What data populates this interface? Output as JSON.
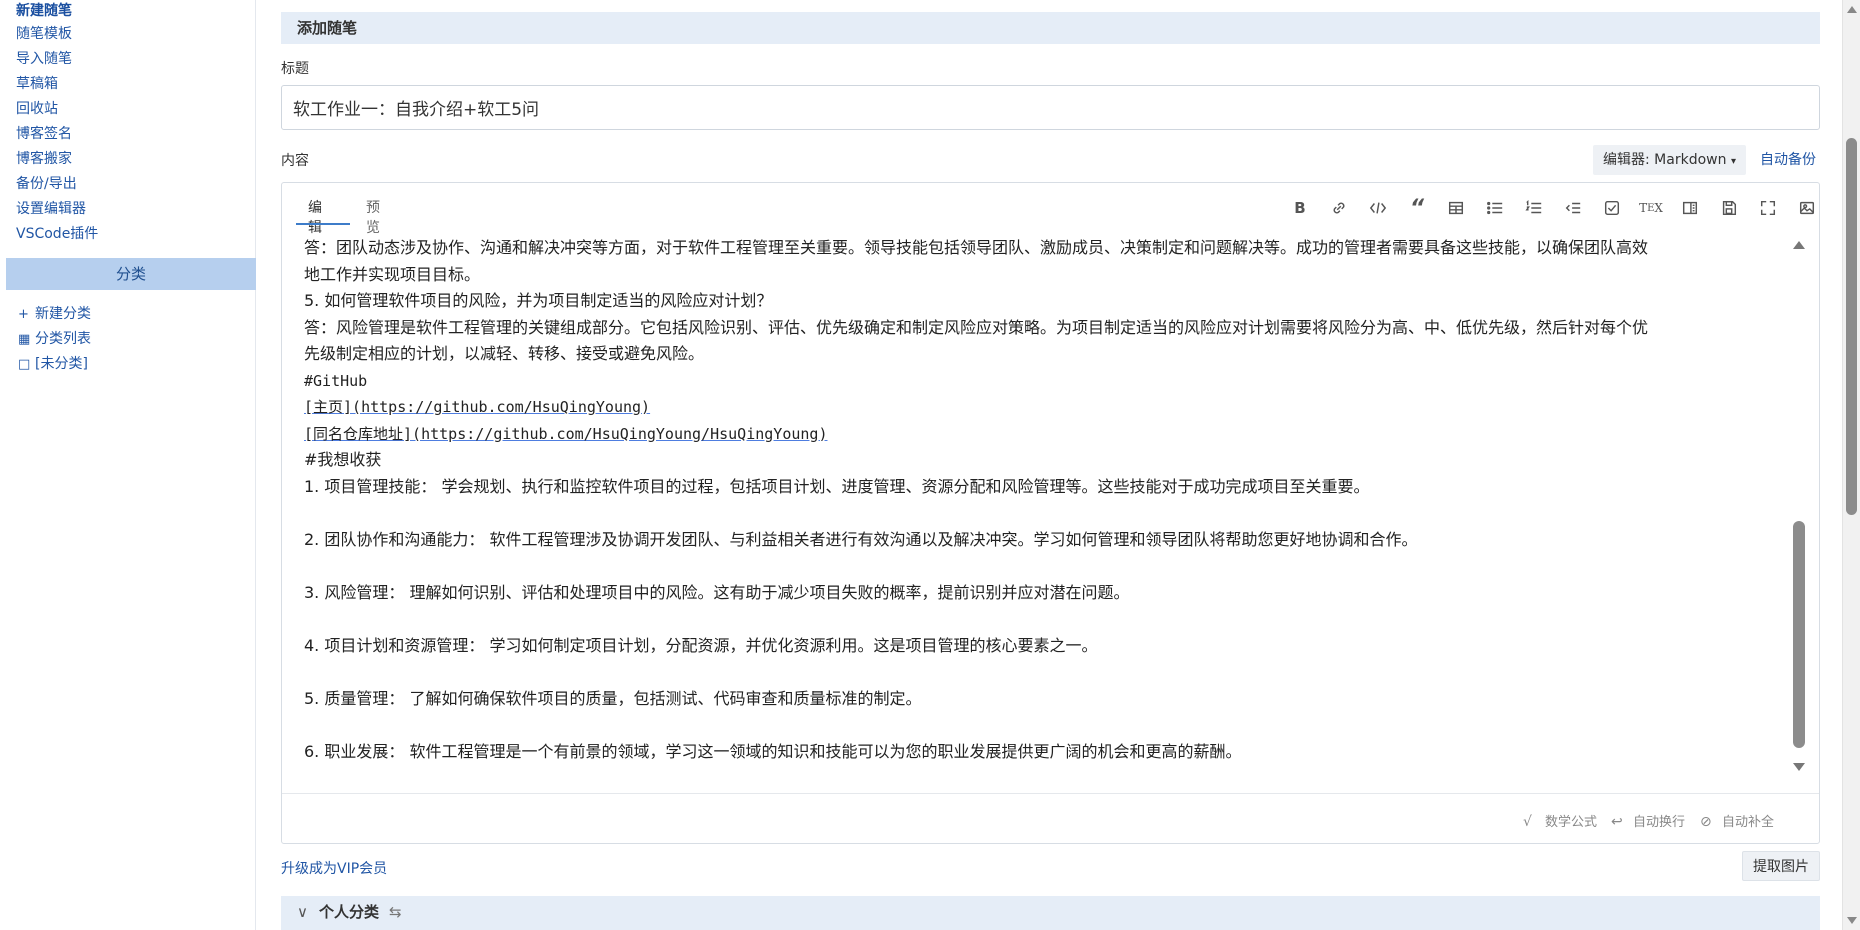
{
  "sidebar": {
    "items": [
      "新建随笔",
      "随笔模板",
      "导入随笔",
      "草稿箱",
      "回收站",
      "博客签名",
      "博客搬家",
      "备份/导出",
      "设置编辑器",
      "VSCode插件"
    ],
    "category_header": "分类",
    "categories": [
      {
        "icon": "plus-icon",
        "label": "新建分类"
      },
      {
        "icon": "list-icon",
        "label": "分类列表"
      },
      {
        "icon": "folder-icon",
        "label": "[未分类]"
      }
    ]
  },
  "main": {
    "section_title": "添加随笔",
    "title_label": "标题",
    "title_value": "软工作业一：自我介绍+软工5问",
    "content_label": "内容",
    "editor_select": "编辑器: Markdown",
    "auto_backup": "自动备份",
    "tabs": {
      "edit": "编辑",
      "preview": "预览"
    },
    "toolbar": [
      "bold-icon",
      "link-icon",
      "code-icon",
      "quote-icon",
      "table-icon",
      "bullet-list-icon",
      "ordered-list-icon",
      "outdent-icon",
      "checkbox-icon",
      "tex-icon",
      "split-view-icon",
      "save-icon",
      "fullscreen-icon",
      "image-icon"
    ],
    "content_lines": [
      "答：团队动态涉及协作、沟通和解决冲突等方面，对于软件工程管理至关重要。领导技能包括领导团队、激励成员、决策制定和问题解决等。成功的管理者需要具备这些技能，以确保团队高效",
      "地工作并实现项目目标。",
      "5. 如何管理软件项目的风险，并为项目制定适当的风险应对计划？",
      "答：风险管理是软件工程管理的关键组成部分。它包括风险识别、评估、优先级确定和制定风险应对策略。为项目制定适当的风险应对计划需要将风险分为高、中、低优先级，然后针对每个优",
      "先级制定相应的计划，以减轻、转移、接受或避免风险。",
      "#GitHub",
      "[主页](https://github.com/HsuQingYoung)",
      "[同名仓库地址](https://github.com/HsuQingYoung/HsuQingYoung)",
      "#我想收获",
      "1. 项目管理技能： 学会规划、执行和监控软件项目的过程，包括项目计划、进度管理、资源分配和风险管理等。这些技能对于成功完成项目至关重要。",
      "",
      "2. 团队协作和沟通能力： 软件工程管理涉及协调开发团队、与利益相关者进行有效沟通以及解决冲突。学习如何管理和领导团队将帮助您更好地协调和合作。",
      "",
      "3. 风险管理： 理解如何识别、评估和处理项目中的风险。这有助于减少项目失败的概率，提前识别并应对潜在问题。",
      "",
      "4. 项目计划和资源管理： 学习如何制定项目计划，分配资源，并优化资源利用。这是项目管理的核心要素之一。",
      "",
      "5. 质量管理： 了解如何确保软件项目的质量，包括测试、代码审查和质量标准的制定。",
      "",
      "6. 职业发展： 软件工程管理是一个有前景的领域，学习这一领域的知识和技能可以为您的职业发展提供更广阔的机会和更高的薪酬。"
    ],
    "footer": {
      "math": "数学公式",
      "wrap": "自动换行",
      "autocomplete": "自动补全"
    },
    "vip_link": "升级成为VIP会员",
    "extract_images": "提取图片",
    "personal_category": "个人分类"
  }
}
